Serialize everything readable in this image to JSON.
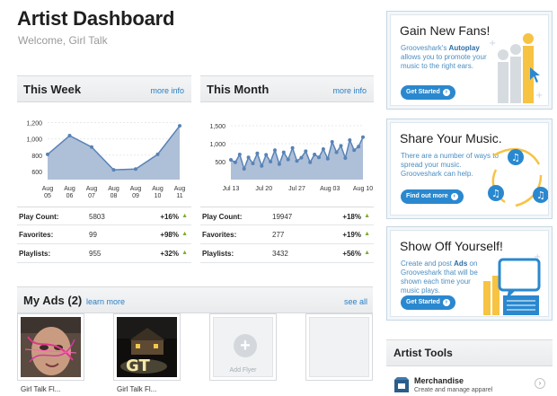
{
  "header": {
    "title": "Artist Dashboard",
    "welcome": "Welcome, Girl Talk"
  },
  "this_week": {
    "title": "This Week",
    "more_link": "more info",
    "stats": [
      {
        "label": "Play Count:",
        "value": "5803",
        "change": "+16%"
      },
      {
        "label": "Favorites:",
        "value": "99",
        "change": "+98%"
      },
      {
        "label": "Playlists:",
        "value": "955",
        "change": "+32%"
      }
    ]
  },
  "this_month": {
    "title": "This Month",
    "more_link": "more info",
    "stats": [
      {
        "label": "Play Count:",
        "value": "19947",
        "change": "+18%"
      },
      {
        "label": "Favorites:",
        "value": "277",
        "change": "+19%"
      },
      {
        "label": "Playlists:",
        "value": "3432",
        "change": "+56%"
      }
    ]
  },
  "my_ads": {
    "title": "My Ads (2)",
    "learn_more": "learn more",
    "see_all": "see all",
    "ads": [
      {
        "caption": "Girl Talk Fl..."
      },
      {
        "caption": "Girl Talk Fl..."
      }
    ],
    "add_flyer": "Add Flyer"
  },
  "promos": [
    {
      "heading": "Gain New Fans!",
      "desc_pre": "Grooveshark's ",
      "desc_bold": "Autoplay",
      "desc_post": " allows you to promote your music to the right ears.",
      "button": "Get Started"
    },
    {
      "heading": "Share Your Music.",
      "desc_pre": "There are a number of ways to spread your music. Grooveshark can help.",
      "button": "Find out more"
    },
    {
      "heading": "Show Off Yourself!",
      "desc_pre": "Create and post ",
      "desc_bold": "Ads",
      "desc_post": " on Grooveshark that will be shown each time your music plays.",
      "button": "Get Started"
    }
  ],
  "artist_tools": {
    "title": "Artist Tools",
    "items": [
      {
        "name": "Merchandise",
        "desc": "Create and manage apparel"
      }
    ]
  },
  "chart_data": [
    {
      "type": "area",
      "y_ticks": [
        "1,200",
        "1,000",
        "800",
        "600"
      ],
      "ylim": [
        500,
        1250
      ],
      "x_ticks": [
        [
          "Aug",
          "05"
        ],
        [
          "Aug",
          "06"
        ],
        [
          "Aug",
          "07"
        ],
        [
          "Aug",
          "08"
        ],
        [
          "Aug",
          "09"
        ],
        [
          "Aug",
          "10"
        ],
        [
          "Aug",
          "11"
        ]
      ],
      "values": [
        810,
        1040,
        900,
        620,
        630,
        810,
        1160
      ]
    },
    {
      "type": "area",
      "y_ticks": [
        "1,500",
        "1,000",
        "500"
      ],
      "ylim": [
        0,
        1700
      ],
      "x_ticks": [
        "Jul 13",
        "Jul 20",
        "Jul 27",
        "Aug 03",
        "Aug 10"
      ],
      "values": [
        550,
        480,
        700,
        300,
        620,
        450,
        730,
        380,
        690,
        500,
        820,
        430,
        760,
        560,
        880,
        520,
        610,
        790,
        480,
        700,
        620,
        850,
        580,
        1050,
        760,
        940,
        600,
        1100,
        820,
        920,
        1180
      ]
    }
  ],
  "colors": {
    "accent": "#2a88cf",
    "link": "#2a7fc4",
    "chart_line": "#5883b6",
    "chart_fill": "#aebfd8",
    "positive": "#7cae2c"
  }
}
